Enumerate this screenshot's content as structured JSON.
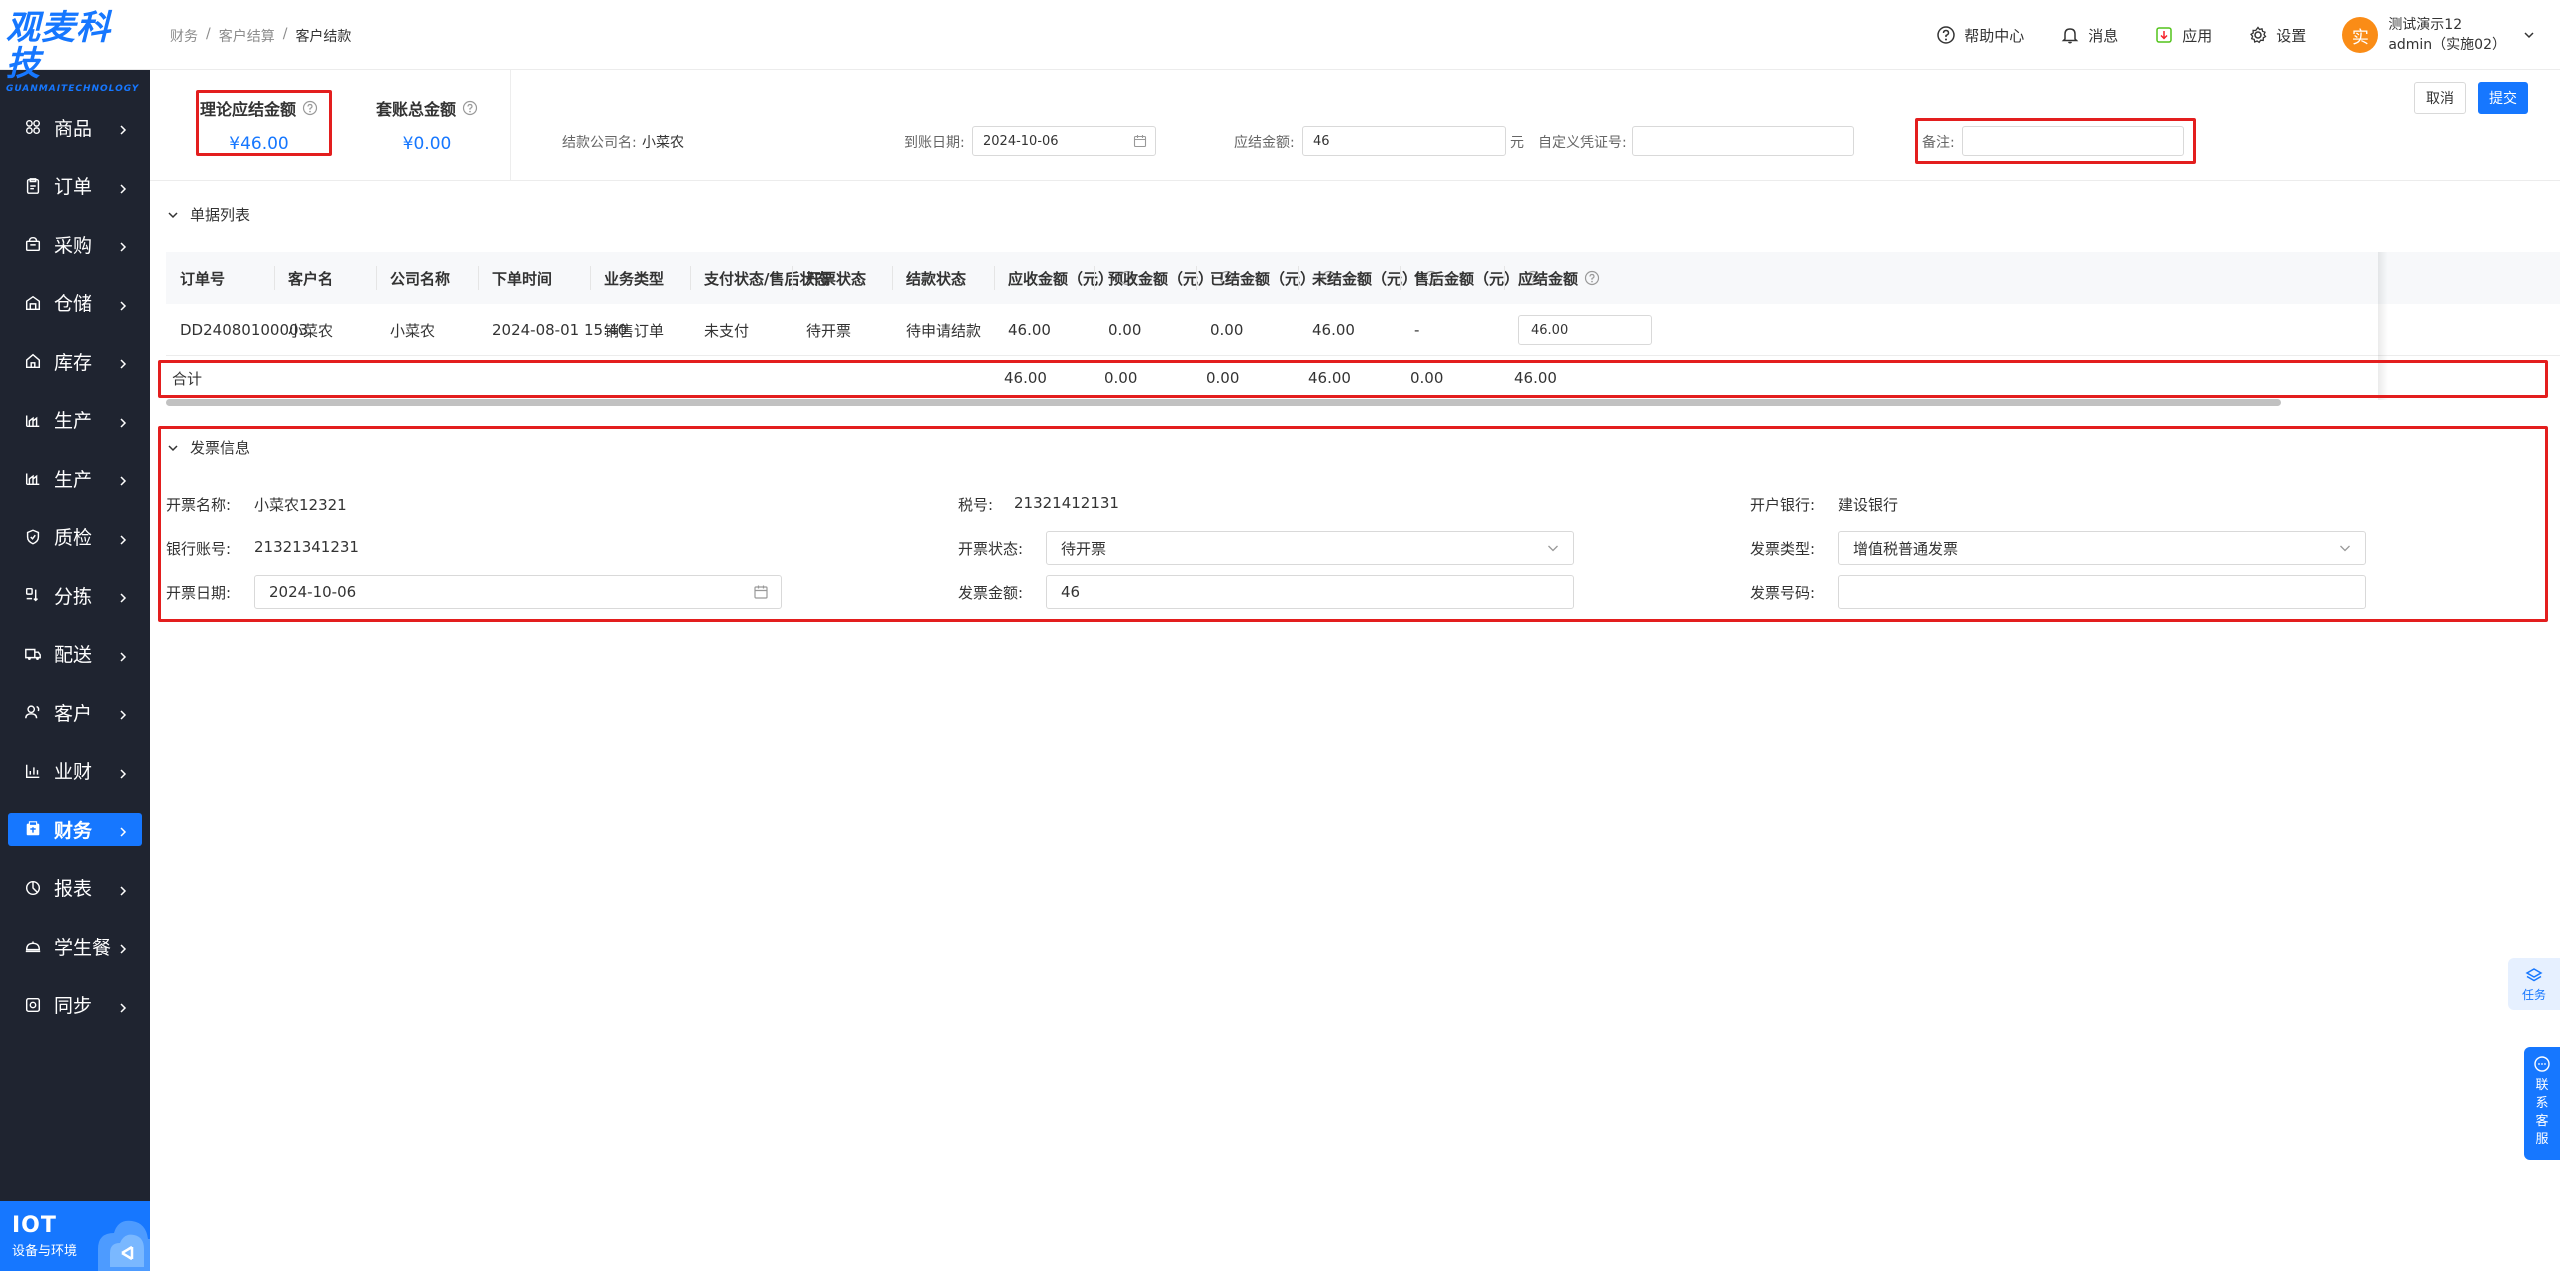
{
  "brand": {
    "logo_text": "观麦科技",
    "logo_sub": "GUANMAITECHNOLOGY"
  },
  "sidebar": {
    "items": [
      {
        "label": "商品",
        "icon": "grid-icon"
      },
      {
        "label": "订单",
        "icon": "order-icon"
      },
      {
        "label": "采购",
        "icon": "purchase-icon"
      },
      {
        "label": "仓储",
        "icon": "warehouse-icon"
      },
      {
        "label": "库存",
        "icon": "inventory-icon"
      },
      {
        "label": "生产",
        "icon": "production-icon"
      },
      {
        "label": "生产",
        "icon": "production-icon"
      },
      {
        "label": "质检",
        "icon": "shield-icon"
      },
      {
        "label": "分拣",
        "icon": "sort-icon"
      },
      {
        "label": "配送",
        "icon": "truck-icon"
      },
      {
        "label": "客户",
        "icon": "user-icon"
      },
      {
        "label": "业财",
        "icon": "bar-chart-icon"
      },
      {
        "label": "财务",
        "icon": "finance-icon",
        "active": true
      },
      {
        "label": "报表",
        "icon": "pie-icon"
      },
      {
        "label": "学生餐",
        "icon": "dish-icon"
      },
      {
        "label": "同步",
        "icon": "sync-icon"
      }
    ],
    "iot": {
      "title": "IOT",
      "subtitle": "设备与环境"
    }
  },
  "header": {
    "breadcrumb": [
      "财务",
      "客户结算",
      "客户结款"
    ],
    "help": "帮助中心",
    "messages": "消息",
    "apps": "应用",
    "settings": "设置",
    "user": {
      "avatar_char": "实",
      "name": "测试演示12",
      "account": "admin（实施02）"
    }
  },
  "summary": {
    "theory_label": "理论应结金额",
    "theory_value": "¥46.00",
    "total_label": "套账总金额",
    "total_value": "¥0.00"
  },
  "form": {
    "company_label": "结款公司名:",
    "company_value": "小菜农",
    "date_label": "到账日期:",
    "date_value": "2024-10-06",
    "amount_label": "应结金额:",
    "amount_value": "46",
    "amount_unit": "元",
    "voucher_label": "自定义凭证号:",
    "voucher_value": "",
    "remark_label": "备注:",
    "remark_value": ""
  },
  "actions": {
    "cancel": "取消",
    "submit": "提交"
  },
  "doc_section": {
    "title": "单据列表"
  },
  "table": {
    "columns": [
      "订单号",
      "客户名",
      "公司名称",
      "下单时间",
      "业务类型",
      "支付状态/售后状态",
      "开票状态",
      "结款状态",
      "应收金额（元）",
      "预收金额（元）",
      "已结金额（元）",
      "未结金额（元）",
      "售后金额（元）",
      "应结金额"
    ],
    "rows": [
      [
        "DD24080100003",
        "小菜农",
        "小菜农",
        "2024-08-01 15:40",
        "销售订单",
        "未支付",
        "待开票",
        "待申请结款",
        "46.00",
        "0.00",
        "0.00",
        "46.00",
        "-",
        "46.00"
      ]
    ],
    "summary": {
      "label": "合计",
      "receivable": "46.00",
      "prepaid": "0.00",
      "settled": "0.00",
      "unsettled": "46.00",
      "after_sale": "0.00",
      "due": "46.00"
    }
  },
  "invoice": {
    "title": "发票信息",
    "name_label": "开票名称:",
    "name_value": "小菜农12321",
    "tax_label": "税号:",
    "tax_value": "21321412131",
    "bank_label": "开户银行:",
    "bank_value": "建设银行",
    "account_label": "银行账号:",
    "account_value": "21321341231",
    "status_label": "开票状态:",
    "status_value": "待开票",
    "type_label": "发票类型:",
    "type_value": "增值税普通发票",
    "date_label": "开票日期:",
    "date_value": "2024-10-06",
    "amount_label": "发票金额:",
    "amount_value": "46",
    "number_label": "发票号码:",
    "number_value": ""
  },
  "floating": {
    "task": "任务",
    "contact": [
      "联",
      "系",
      "客",
      "服"
    ]
  },
  "colors": {
    "primary": "#1677ff",
    "sidebar_bg": "#1f2430",
    "highlight_border": "#e31e1e"
  }
}
